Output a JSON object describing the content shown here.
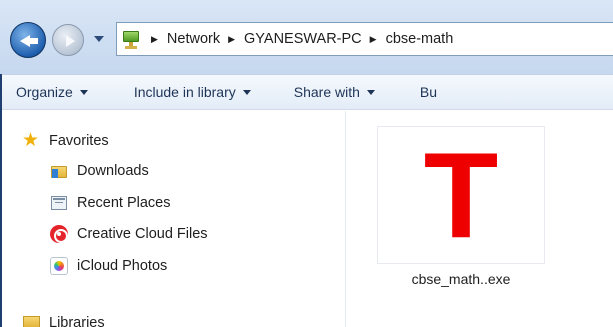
{
  "address_bar": {
    "location_icon": "network-computer-icon",
    "breadcrumbs": [
      "Network",
      "GYANESWAR-PC",
      "cbse-math"
    ]
  },
  "toolbar": {
    "organize_label": "Organize",
    "include_library_label": "Include in library",
    "share_with_label": "Share with",
    "burn_label": "Bu"
  },
  "navigation_pane": {
    "favorites_label": "Favorites",
    "items": [
      {
        "label": "Downloads",
        "icon": "downloads-folder-icon"
      },
      {
        "label": "Recent Places",
        "icon": "recent-places-icon"
      },
      {
        "label": "Creative Cloud Files",
        "icon": "creative-cloud-icon"
      },
      {
        "label": "iCloud Photos",
        "icon": "icloud-photos-icon"
      }
    ],
    "libraries_label": "Libraries"
  },
  "content": {
    "file": {
      "name": "cbse_math..exe",
      "icon_glyph": "T",
      "icon_color": "#ee0000"
    }
  },
  "colors": {
    "address_bar_bg": "#c6d8ef",
    "toolbar_text": "#1e3456",
    "frame_border": "#1f3f73"
  }
}
